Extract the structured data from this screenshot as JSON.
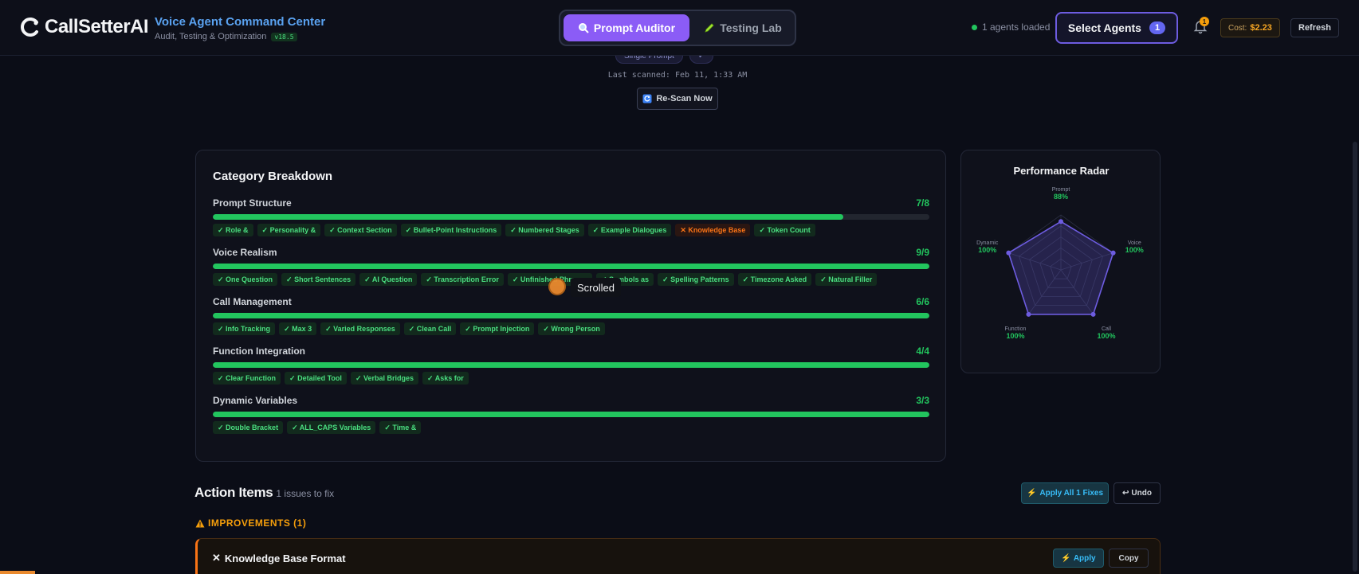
{
  "header": {
    "logo_text": "CallSetterAI",
    "app_title": "Voice Agent Command Center",
    "app_subtitle": "Audit, Testing & Optimization",
    "version": "v18.5",
    "tabs": [
      {
        "label": "Prompt Auditor",
        "icon": "magnifier-icon",
        "active": true
      },
      {
        "label": "Testing Lab",
        "icon": "pencil-icon",
        "active": false
      }
    ],
    "agents_loaded": "1 agents loaded",
    "select_agents_label": "Select Agents",
    "select_agents_count": "1",
    "notification_count": "1",
    "cost_label": "Cost:",
    "cost_value": "$2.23",
    "refresh_label": "Refresh"
  },
  "scan": {
    "chips": [
      "Single Prompt",
      "✓"
    ],
    "last_scanned": "Last scanned: Feb 11, 1:33 AM",
    "rescan_label": "Re-Scan Now"
  },
  "breakdown": {
    "title": "Category Breakdown",
    "categories": [
      {
        "name": "Prompt Structure",
        "score": "7/8",
        "fill": 0.88,
        "pills": [
          {
            "text": "✓ Role &",
            "pass": true
          },
          {
            "text": "✓ Personality &",
            "pass": true
          },
          {
            "text": "✓ Context Section",
            "pass": true
          },
          {
            "text": "✓ Bullet-Point Instructions",
            "pass": true
          },
          {
            "text": "✓ Numbered Stages",
            "pass": true
          },
          {
            "text": "✓ Example Dialogues",
            "pass": true
          },
          {
            "text": "✕ Knowledge Base",
            "pass": false
          },
          {
            "text": "✓ Token Count",
            "pass": true
          }
        ]
      },
      {
        "name": "Voice Realism",
        "score": "9/9",
        "fill": 1.0,
        "pills": [
          {
            "text": "✓ One Question",
            "pass": true
          },
          {
            "text": "✓ Short Sentences",
            "pass": true
          },
          {
            "text": "✓ AI Question",
            "pass": true
          },
          {
            "text": "✓ Transcription Error",
            "pass": true
          },
          {
            "text": "✓ Unfinished Phrases",
            "pass": true
          },
          {
            "text": "✓ Symbols as",
            "pass": true
          },
          {
            "text": "✓ Spelling Patterns",
            "pass": true
          },
          {
            "text": "✓ Timezone Asked",
            "pass": true
          },
          {
            "text": "✓ Natural Filler",
            "pass": true
          }
        ]
      },
      {
        "name": "Call Management",
        "score": "6/6",
        "fill": 1.0,
        "pills": [
          {
            "text": "✓ Info Tracking",
            "pass": true
          },
          {
            "text": "✓ Max 3",
            "pass": true
          },
          {
            "text": "✓ Varied Responses",
            "pass": true
          },
          {
            "text": "✓ Clean Call",
            "pass": true
          },
          {
            "text": "✓ Prompt Injection",
            "pass": true
          },
          {
            "text": "✓ Wrong Person",
            "pass": true
          }
        ]
      },
      {
        "name": "Function Integration",
        "score": "4/4",
        "fill": 1.0,
        "pills": [
          {
            "text": "✓ Clear Function",
            "pass": true
          },
          {
            "text": "✓ Detailed Tool",
            "pass": true
          },
          {
            "text": "✓ Verbal Bridges",
            "pass": true
          },
          {
            "text": "✓ Asks for",
            "pass": true
          }
        ]
      },
      {
        "name": "Dynamic Variables",
        "score": "3/3",
        "fill": 1.0,
        "pills": [
          {
            "text": "✓ Double Bracket",
            "pass": true
          },
          {
            "text": "✓ ALL_CAPS Variables",
            "pass": true
          },
          {
            "text": "✓ Time &",
            "pass": true
          }
        ]
      }
    ]
  },
  "radar": {
    "title": "Performance Radar",
    "axes": [
      {
        "label": "Prompt",
        "value": "88%",
        "score": 0.88
      },
      {
        "label": "Voice",
        "value": "100%",
        "score": 1.0
      },
      {
        "label": "Call",
        "value": "100%",
        "score": 1.0
      },
      {
        "label": "Function",
        "value": "100%",
        "score": 1.0
      },
      {
        "label": "Dynamic",
        "value": "100%",
        "score": 1.0
      }
    ],
    "accent": "#6d5ce0"
  },
  "tooltip": "Scrolled",
  "actions": {
    "title": "Action Items",
    "subtitle": "1 issues to fix",
    "apply_all_label": "Apply All 1 Fixes",
    "undo_label": "Undo",
    "improvements_label": "IMPROVEMENTS (1)",
    "issue_title": "Knowledge Base Format",
    "issue_apply_label": "Apply",
    "issue_copy_label": "Copy"
  },
  "colors": {
    "pass": "#22c55e",
    "fail": "#f97316",
    "accent": "#8b5cf6",
    "warning": "#f59e0b"
  }
}
